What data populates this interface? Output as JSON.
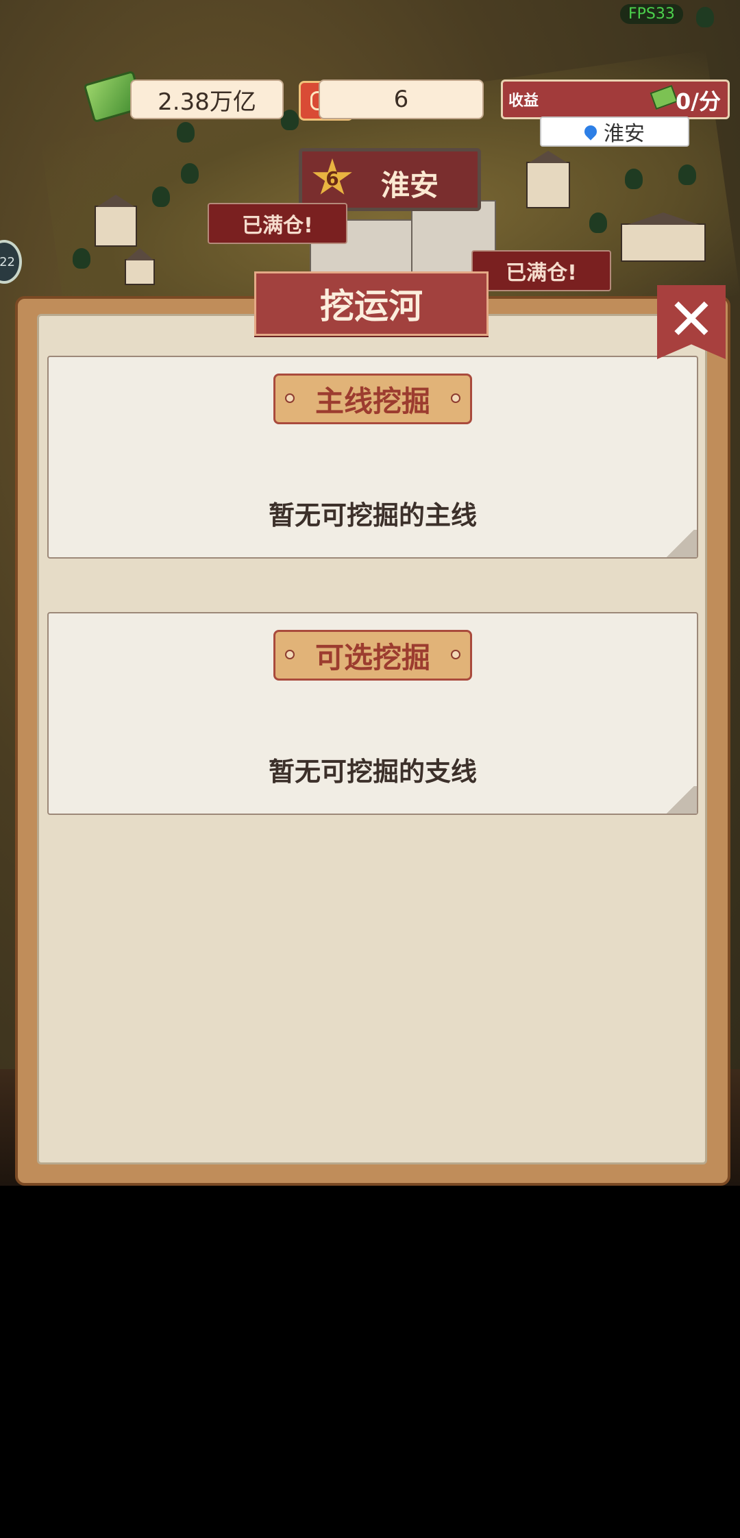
{
  "hud": {
    "fps": "FPS33",
    "money": "2.38万亿",
    "tickets": "6",
    "income_label": "收益",
    "income_rate": "0/分",
    "location": "淮安",
    "side_counter": "22"
  },
  "city_banner": {
    "level": "6",
    "name": "淮安"
  },
  "map_tags": {
    "warehouse_full_1": "已满仓!",
    "warehouse_full_2": "已满仓!"
  },
  "modal": {
    "title": "挖运河",
    "close_icon": "close-icon",
    "main_section": {
      "tag": "主线挖掘",
      "empty_message": "暂无可挖掘的主线"
    },
    "optional_section": {
      "tag": "可选挖掘",
      "empty_message": "暂无可挖掘的支线"
    }
  },
  "colors": {
    "banner_red": "#a2413e",
    "panel_bg": "#e6dcc7",
    "frame": "#c08d5a",
    "tag_bg": "#e1b378"
  }
}
